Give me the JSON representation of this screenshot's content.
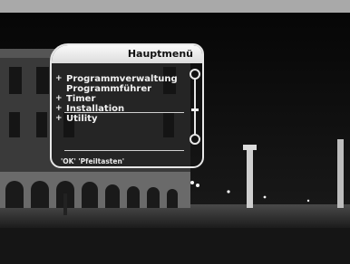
{
  "menu": {
    "title": "Hauptmenü",
    "items": [
      {
        "label": "Programmverwaltung",
        "bullet": "+"
      },
      {
        "label": "Programmführer",
        "bullet": ""
      },
      {
        "label": "Timer",
        "bullet": "+"
      },
      {
        "label": "Installation",
        "bullet": "+"
      },
      {
        "label": "Utility",
        "bullet": "+"
      }
    ],
    "selected_index": 3,
    "hint": "'OK' 'Pfeiltasten'"
  },
  "colors": {
    "frame": "#e8e8e8",
    "header": "#f0f0f0",
    "top_bar": "#a9a9a9"
  }
}
